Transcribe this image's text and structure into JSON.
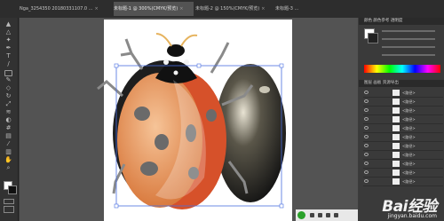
{
  "tabs": [
    {
      "title": "Nga_3254350 20180331107.0 ...",
      "active": false
    },
    {
      "title": "未标题-1 @ 300%(CMYK/预览)",
      "active": true
    },
    {
      "title": "未标题-2 @ 150%(CMYK/预览)",
      "active": false
    },
    {
      "title": "未标题-3 ...",
      "active": false
    }
  ],
  "toolbar": {
    "tools": [
      "selection",
      "direct-selection",
      "magic-wand",
      "lasso",
      "pen",
      "type",
      "line",
      "rectangle",
      "paintbrush",
      "pencil",
      "eraser",
      "rotate",
      "scale",
      "width",
      "free-transform",
      "shape-builder",
      "perspective",
      "mesh",
      "gradient",
      "eyedropper",
      "blend",
      "symbol-sprayer",
      "graph",
      "artboard",
      "slice",
      "hand",
      "zoom"
    ]
  },
  "panels": {
    "color_header": "颜色  颜色参考  透明度",
    "layers_header": "图层  画板  资源导出",
    "layers": [
      "<路径>",
      "<路径>",
      "<路径>",
      "<路径>",
      "<路径>",
      "<路径>",
      "<路径>",
      "<路径>",
      "<路径>",
      "<路径>",
      "<路径>"
    ]
  },
  "statusbar": {
    "icons": [
      "sogou-icon",
      "punctuation-icon",
      "emoji-icon",
      "keyboard-icon",
      "settings-icon"
    ]
  },
  "watermark": {
    "brand": "Bai经验",
    "domain": "jingyan.baidu.com"
  },
  "colors": {
    "ladybug_red": "#d6512a",
    "ladybug_orange": "#e39a62",
    "wing_dark": "#202020",
    "selection_blue": "#4a6ee0"
  }
}
